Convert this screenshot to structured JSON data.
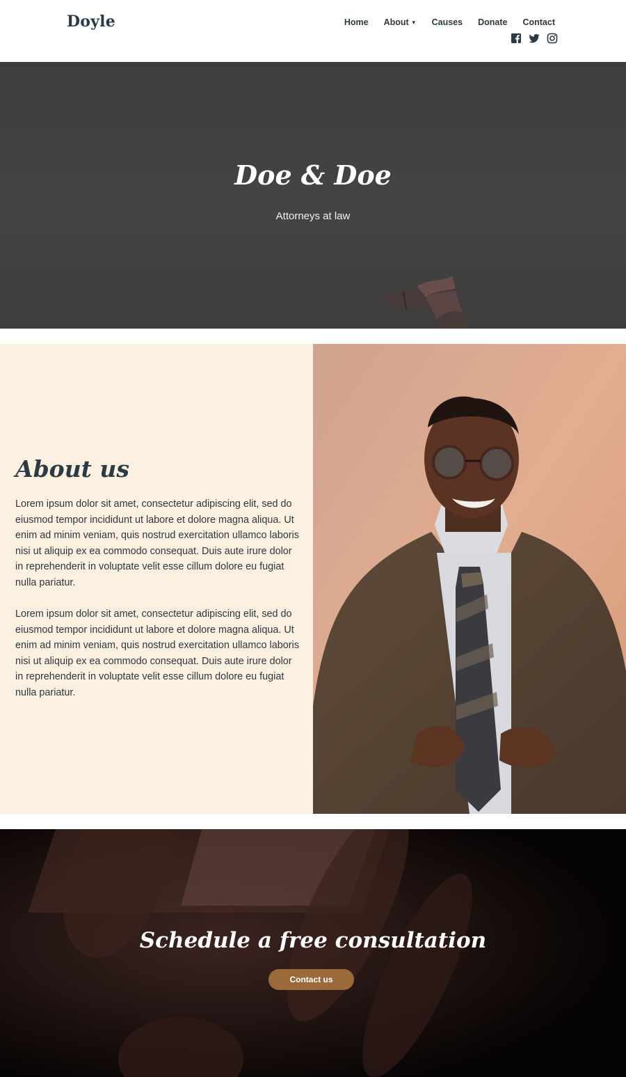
{
  "header": {
    "logo": "Doyle",
    "nav": [
      {
        "label": "Home"
      },
      {
        "label": "About",
        "has_dropdown": true
      },
      {
        "label": "Causes"
      },
      {
        "label": "Donate"
      },
      {
        "label": "Contact"
      }
    ],
    "social_icons": [
      "facebook-icon",
      "twitter-icon",
      "instagram-icon"
    ]
  },
  "hero": {
    "title": "Doe & Doe",
    "subtitle": "Attorneys at law"
  },
  "about": {
    "heading": "About us",
    "paragraphs": [
      "Lorem ipsum dolor sit amet, consectetur adipiscing elit, sed do eiusmod tempor incididunt ut labore et dolore magna aliqua. Ut enim ad minim veniam, quis nostrud exercitation ullamco laboris nisi ut aliquip ex ea commodo consequat. Duis aute irure dolor in reprehenderit in voluptate velit esse cillum dolore eu fugiat nulla pariatur.",
      "Lorem ipsum dolor sit amet, consectetur adipiscing elit, sed do eiusmod tempor incididunt ut labore et dolore magna aliqua. Ut enim ad minim veniam, quis nostrud exercitation ullamco laboris nisi ut aliquip ex ea commodo consequat. Duis aute irure dolor in reprehenderit in voluptate velit esse cillum dolore eu fugiat nulla pariatur."
    ]
  },
  "cta": {
    "title": "Schedule a free consultation",
    "button_label": "Contact us"
  },
  "colors": {
    "text_dark": "#2b3a45",
    "about_bg": "#fcf0e0",
    "hero_bg": "#424242",
    "cta_button": "#9a6a3a",
    "cta_bg": "#0b0706"
  }
}
